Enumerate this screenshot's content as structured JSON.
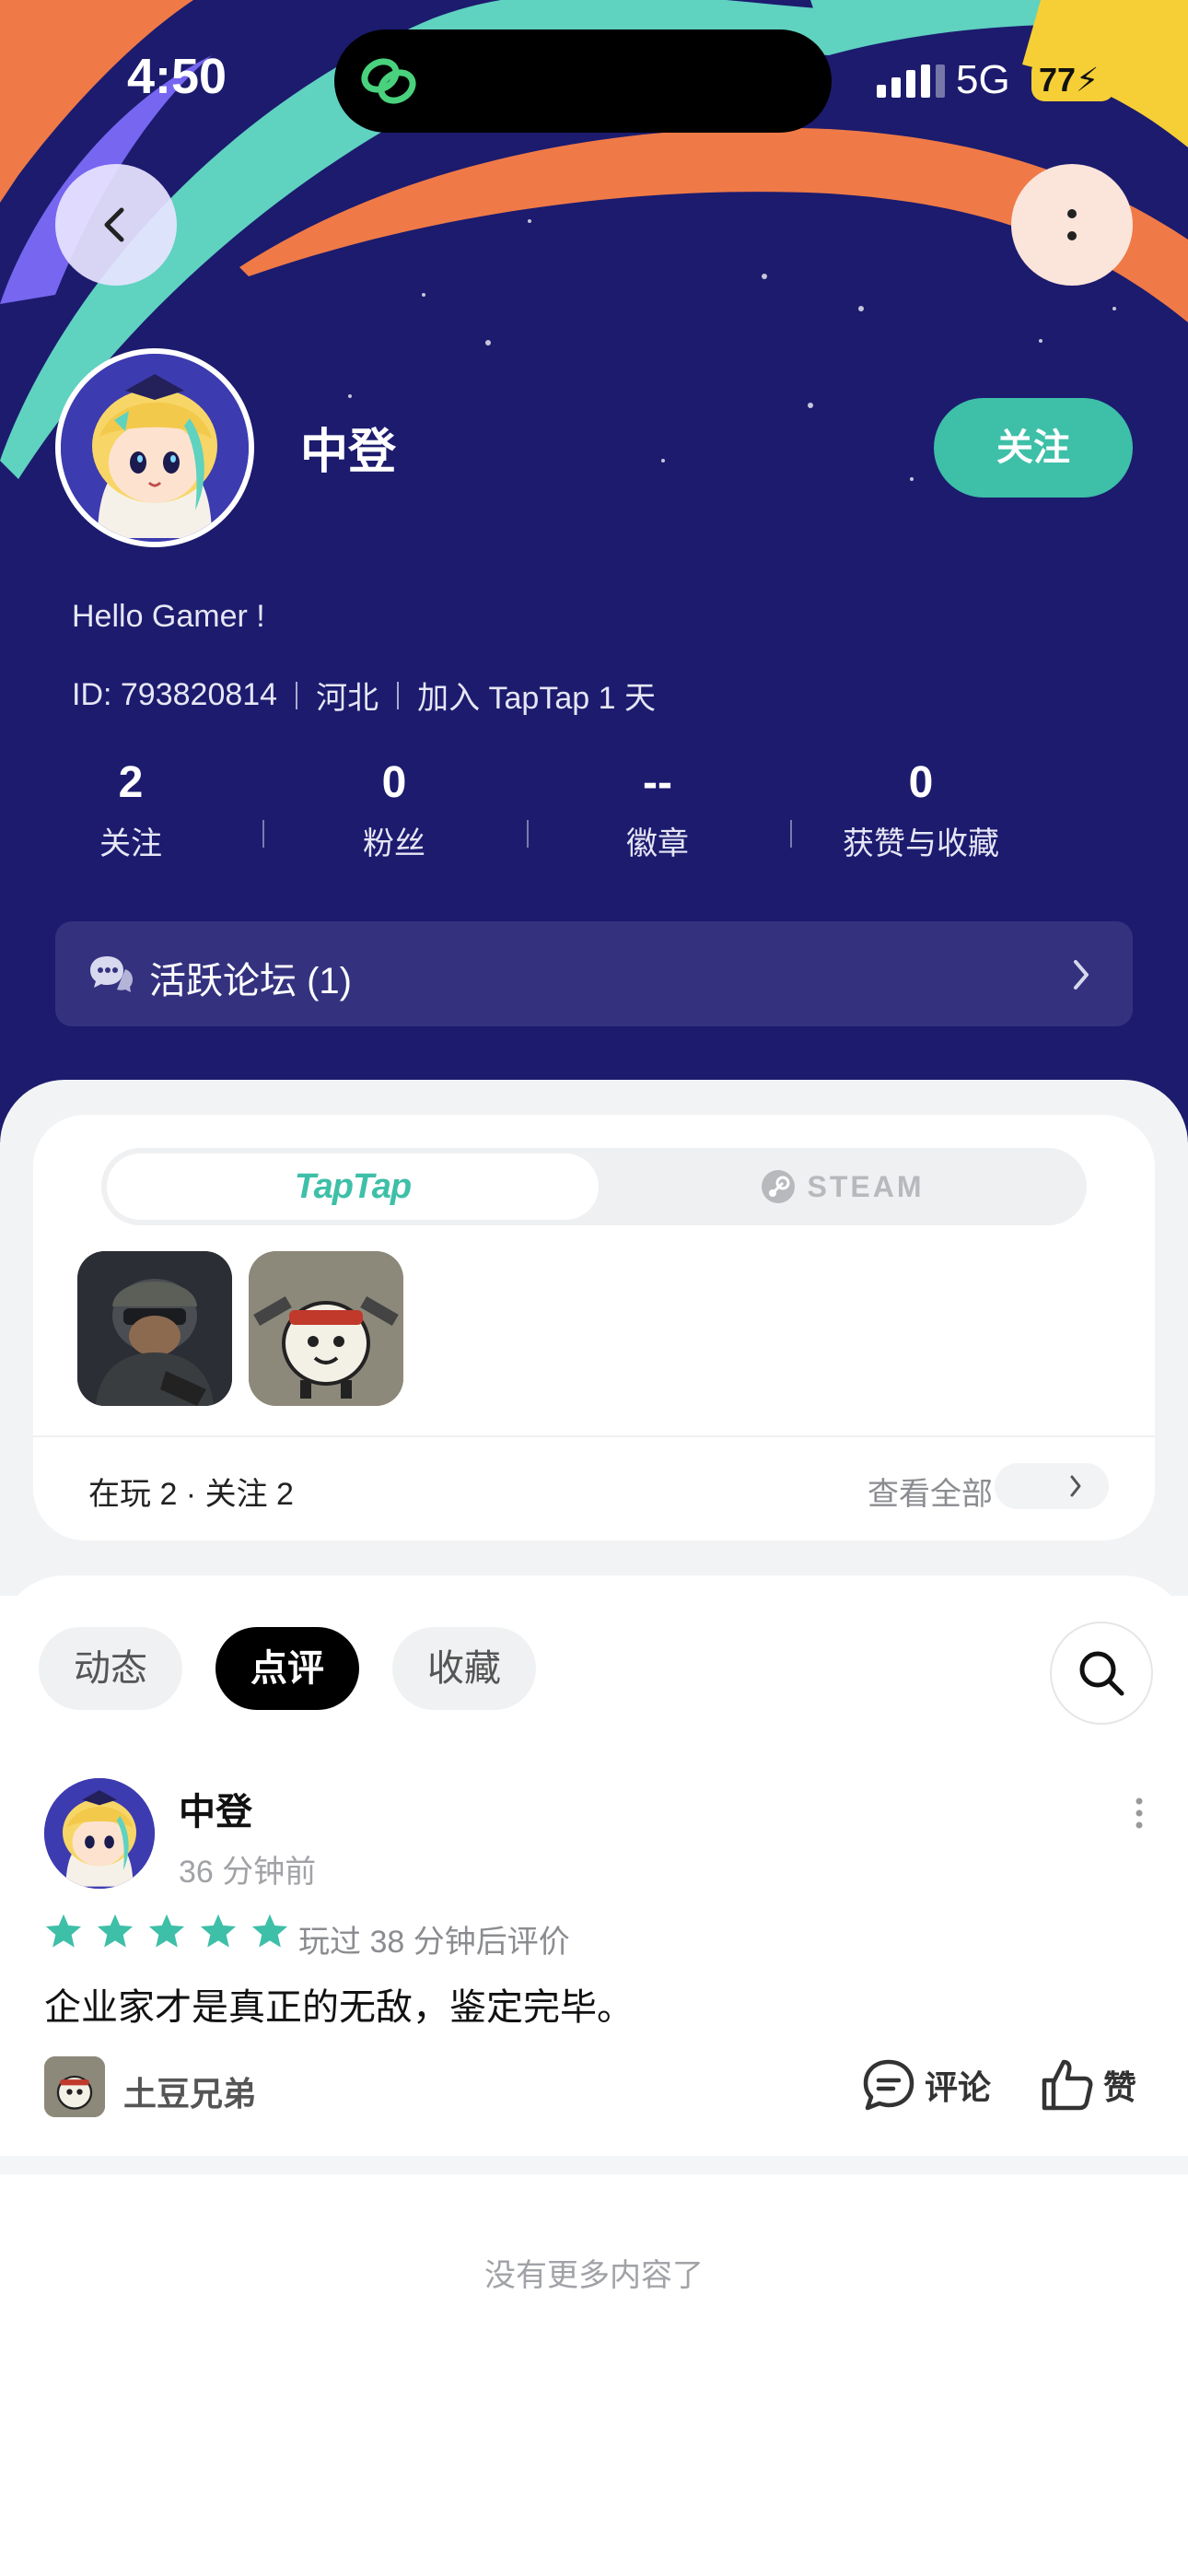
{
  "status_bar": {
    "time": "4:50",
    "network": "5G",
    "battery": "77"
  },
  "profile": {
    "name": "中登",
    "follow_label": "关注",
    "bio": "Hello Gamer !",
    "id_text": "ID: 793820814",
    "region": "河北",
    "joined": "加入 TapTap 1 天"
  },
  "stats": [
    {
      "value": "2",
      "label": "关注"
    },
    {
      "value": "0",
      "label": "粉丝"
    },
    {
      "value": "--",
      "label": "徽章"
    },
    {
      "value": "0",
      "label": "获赞与收藏"
    }
  ],
  "forum": {
    "label": "活跃论坛 (1)"
  },
  "games": {
    "platforms": [
      "TapTap",
      "STEAM"
    ],
    "selected_platform": "TapTap",
    "summary": "在玩 2 · 关注 2",
    "view_all": "查看全部"
  },
  "tabs": [
    {
      "label": "动态",
      "active": false
    },
    {
      "label": "点评",
      "active": true
    },
    {
      "label": "收藏",
      "active": false
    }
  ],
  "post": {
    "author": "中登",
    "time": "36 分钟前",
    "rating": 5,
    "played": "玩过 38 分钟后评价",
    "text": "企业家才是真正的无敌，鉴定完毕。",
    "game": "土豆兄弟",
    "comment_label": "评论",
    "like_label": "赞"
  },
  "footer": {
    "no_more": "没有更多内容了"
  },
  "colors": {
    "header_bg": "#1c1b6e",
    "accent": "#3ebfa8",
    "star": "#3ebfa8",
    "battery": "#f5cf35"
  }
}
